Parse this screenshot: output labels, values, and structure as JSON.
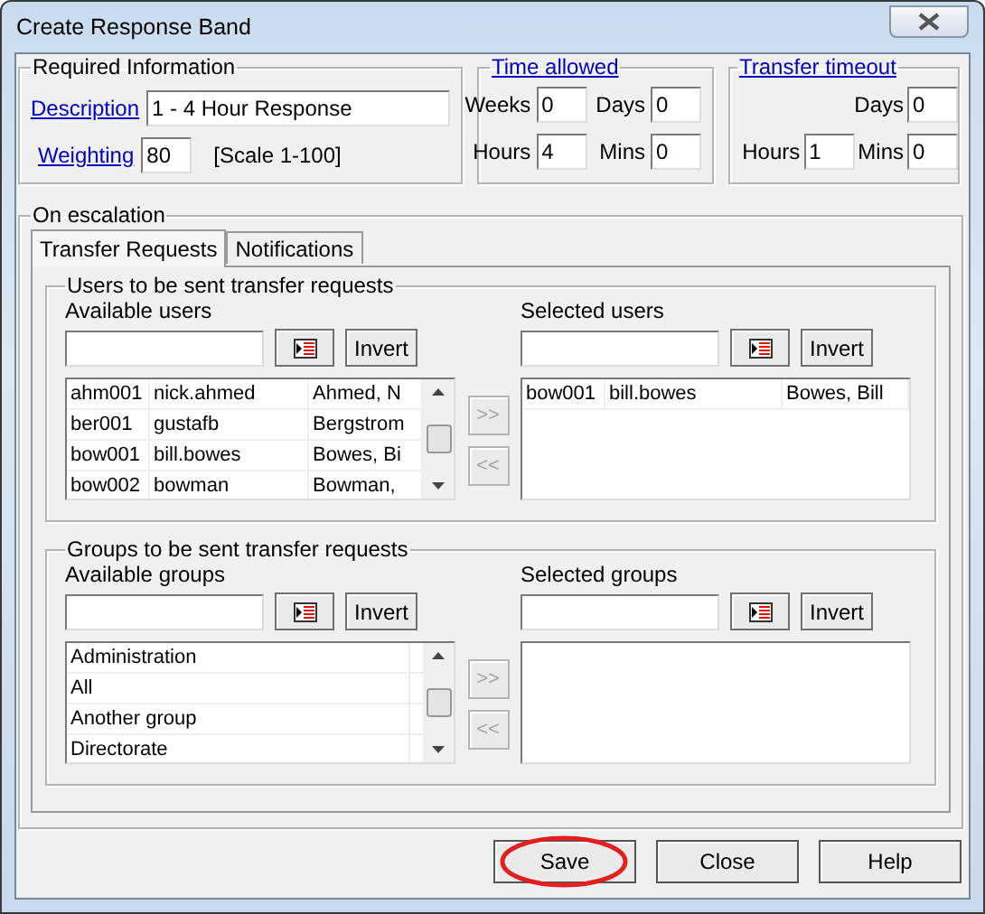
{
  "window": {
    "title": "Create Response Band"
  },
  "required_information": {
    "legend": "Required Information",
    "description_label": "Description",
    "description_value": "1 - 4 Hour Response",
    "weighting_label": "Weighting",
    "weighting_value": "80",
    "scale_note": "[Scale 1-100]"
  },
  "time_allowed": {
    "legend": "Time allowed",
    "fields": [
      {
        "label": "Weeks",
        "value": "0"
      },
      {
        "label": "Days",
        "value": "0"
      },
      {
        "label": "Hours",
        "value": "4"
      },
      {
        "label": "Mins",
        "value": "0"
      }
    ]
  },
  "transfer_timeout": {
    "legend": "Transfer timeout",
    "fields": [
      {
        "label": "Days",
        "value": "0"
      },
      {
        "label": "Hours",
        "value": "1"
      },
      {
        "label": "Mins",
        "value": "0"
      }
    ]
  },
  "escalation": {
    "legend": "On escalation",
    "tabs": [
      {
        "label": "Transfer Requests",
        "selected": true
      },
      {
        "label": "Notifications",
        "selected": false
      }
    ],
    "sections": [
      {
        "legend": "Users to be sent transfer requests",
        "available_label": "Available users",
        "selected_label": "Selected users",
        "available_invert_label": "Invert",
        "selected_invert_label": "Invert",
        "available_rows": [
          [
            "ahm001",
            "nick.ahmed",
            "Ahmed, N"
          ],
          [
            "ber001",
            "gustafb",
            "Bergstrom"
          ],
          [
            "bow001",
            "bill.bowes",
            "Bowes, Bi"
          ],
          [
            "bow002",
            "bowman",
            "Bowman,"
          ]
        ],
        "selected_rows": [
          [
            "bow001",
            "bill.bowes",
            "Bowes, Bill"
          ]
        ],
        "move_buttons": [
          {
            "label": ">>",
            "disabled": true
          },
          {
            "label": "<<",
            "disabled": true
          }
        ]
      },
      {
        "legend": "Groups to be sent transfer requests",
        "available_label": "Available groups",
        "selected_label": "Selected groups",
        "available_invert_label": "Invert",
        "selected_invert_label": "Invert",
        "available_rows": [
          [
            "Administration"
          ],
          [
            "All"
          ],
          [
            "Another group"
          ],
          [
            "Directorate"
          ]
        ],
        "move_buttons": [
          {
            "label": ">>",
            "disabled": true
          },
          {
            "label": "<<",
            "disabled": true
          }
        ]
      }
    ]
  },
  "buttons": [
    {
      "label": "Save",
      "circled": true
    },
    {
      "label": "Close",
      "circled": false
    },
    {
      "label": "Help",
      "circled": false
    }
  ]
}
